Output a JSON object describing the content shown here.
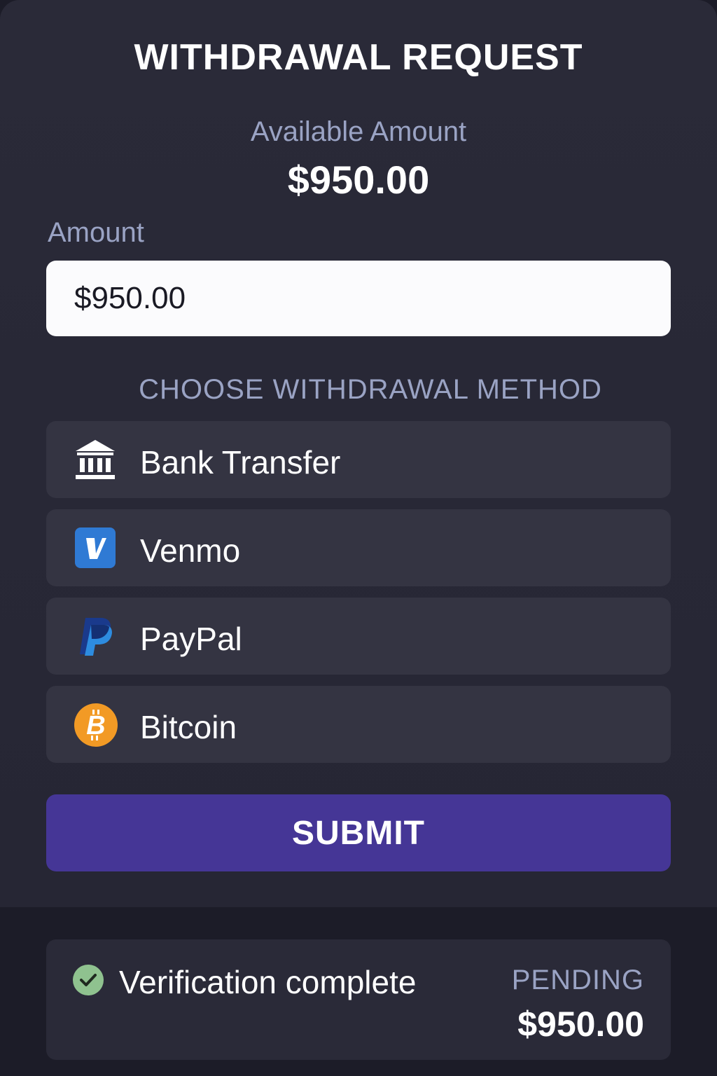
{
  "header": {
    "title": "WITHDRAWAL REQUEST"
  },
  "balance": {
    "label": "Available Amount",
    "value": "$950.00"
  },
  "amount_field": {
    "label": "Amount",
    "value": "$950.00"
  },
  "methods": {
    "heading": "CHOOSE WITHDRAWAL METHOD",
    "items": [
      {
        "label": "Bank Transfer",
        "icon": "bank-icon"
      },
      {
        "label": "Venmo",
        "icon": "venmo-icon"
      },
      {
        "label": "PayPal",
        "icon": "paypal-icon"
      },
      {
        "label": "Bitcoin",
        "icon": "bitcoin-icon"
      }
    ]
  },
  "submit": {
    "label": "SUBMIT"
  },
  "status": {
    "message": "Verification complete",
    "state_label": "PENDING",
    "amount": "$950.00"
  },
  "colors": {
    "background": "#1c1c28",
    "panel": "#2a2a38",
    "option": "#343442",
    "accent": "#453696",
    "muted_text": "#9aa3c4",
    "venmo": "#2f7ad4",
    "paypal_dark": "#1a3a8c",
    "paypal_light": "#2d8ce0",
    "bitcoin": "#f29a25",
    "success": "#8fc28f"
  }
}
